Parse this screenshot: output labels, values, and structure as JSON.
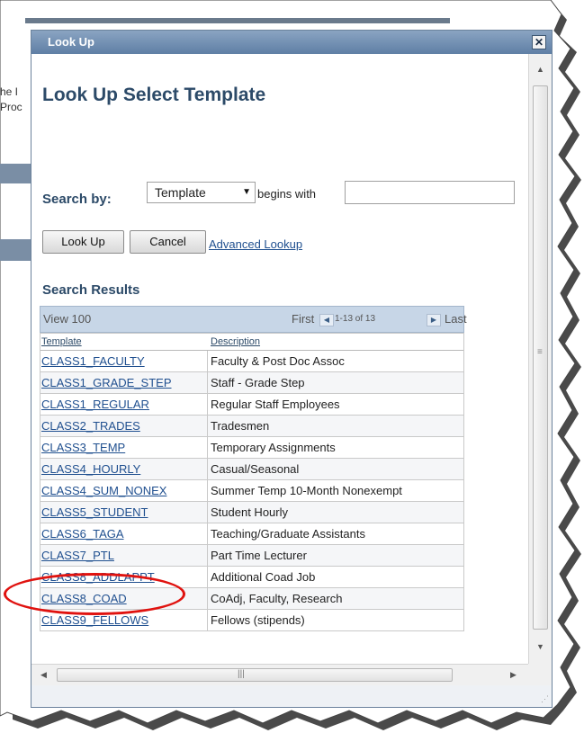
{
  "background": {
    "fragments": [
      "he I",
      "Proc"
    ]
  },
  "dialog": {
    "title": "Look Up",
    "close_icon": "close-icon"
  },
  "page": {
    "title": "Look Up Select Template"
  },
  "search": {
    "label": "Search by:",
    "field_selected": "Template",
    "operator_text": "begins with",
    "input_value": ""
  },
  "buttons": {
    "lookup": "Look Up",
    "cancel": "Cancel",
    "advanced": "Advanced Lookup"
  },
  "results": {
    "title": "Search Results",
    "view_all": "View 100",
    "first": "First",
    "count": "1-13 of 13",
    "last": "Last",
    "columns": [
      "Template",
      "Description"
    ],
    "rows": [
      {
        "template": "CLASS1_FACULTY",
        "description": "Faculty & Post Doc Assoc"
      },
      {
        "template": "CLASS1_GRADE_STEP",
        "description": "Staff - Grade Step"
      },
      {
        "template": "CLASS1_REGULAR",
        "description": "Regular Staff Employees"
      },
      {
        "template": "CLASS2_TRADES",
        "description": "Tradesmen"
      },
      {
        "template": "CLASS3_TEMP",
        "description": "Temporary Assignments"
      },
      {
        "template": "CLASS4_HOURLY",
        "description": "Casual/Seasonal"
      },
      {
        "template": "CLASS4_SUM_NONEX",
        "description": "Summer Temp 10-Month Nonexempt"
      },
      {
        "template": "CLASS5_STUDENT",
        "description": "Student Hourly"
      },
      {
        "template": "CLASS6_TAGA",
        "description": "Teaching/Graduate Assistants"
      },
      {
        "template": "CLASS7_PTL",
        "description": "Part Time Lecturer"
      },
      {
        "template": "CLASS8_ADDLAPPT",
        "description": "Additional Coad Job"
      },
      {
        "template": "CLASS8_COAD",
        "description": "CoAdj, Faculty, Research"
      },
      {
        "template": "CLASS9_FELLOWS",
        "description": "Fellows (stipends)"
      }
    ]
  },
  "annotation": {
    "highlighted_row": "CLASS9_FELLOWS",
    "color": "#e0120f"
  },
  "colors": {
    "heading": "#2c4a68",
    "link": "#1f4f8f",
    "titlebar": "#5f7fa5",
    "nav_band": "#c7d6e7"
  }
}
